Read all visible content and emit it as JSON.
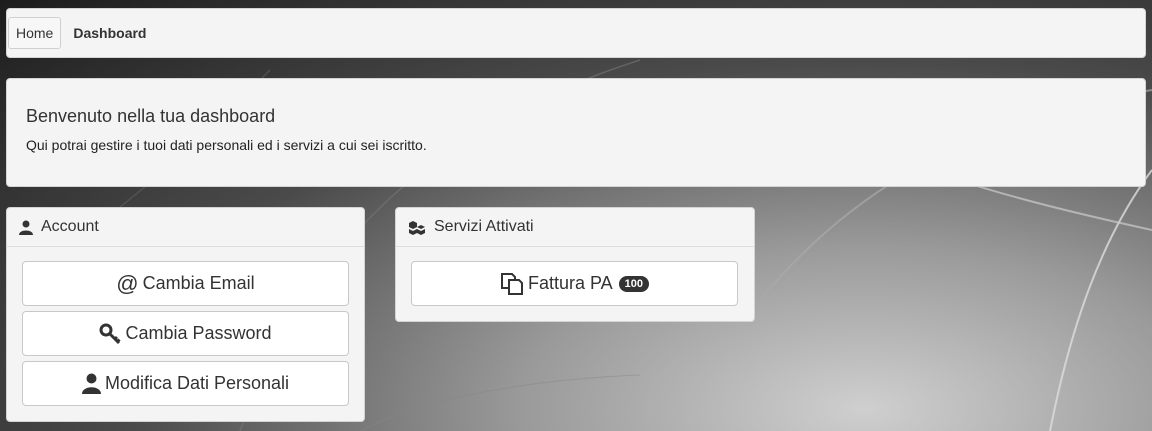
{
  "breadcrumb": {
    "home": "Home",
    "current": "Dashboard"
  },
  "welcome": {
    "title": "Benvenuto nella tua dashboard",
    "text": "Qui potrai gestire i tuoi dati personali ed i servizi a cui sei iscritto."
  },
  "account": {
    "title": "Account",
    "buttons": [
      {
        "label": "Cambia Email",
        "icon": "at-icon"
      },
      {
        "label": "Cambia Password",
        "icon": "key-icon"
      },
      {
        "label": "Modifica Dati Personali",
        "icon": "user-icon"
      }
    ]
  },
  "services": {
    "title": "Servizi Attivati",
    "buttons": [
      {
        "label": "Fattura PA",
        "icon": "copy-icon",
        "badge": "100"
      }
    ]
  },
  "colors": {
    "panel": "#f4f4f4",
    "badge": "#333333",
    "text": "#333333"
  }
}
